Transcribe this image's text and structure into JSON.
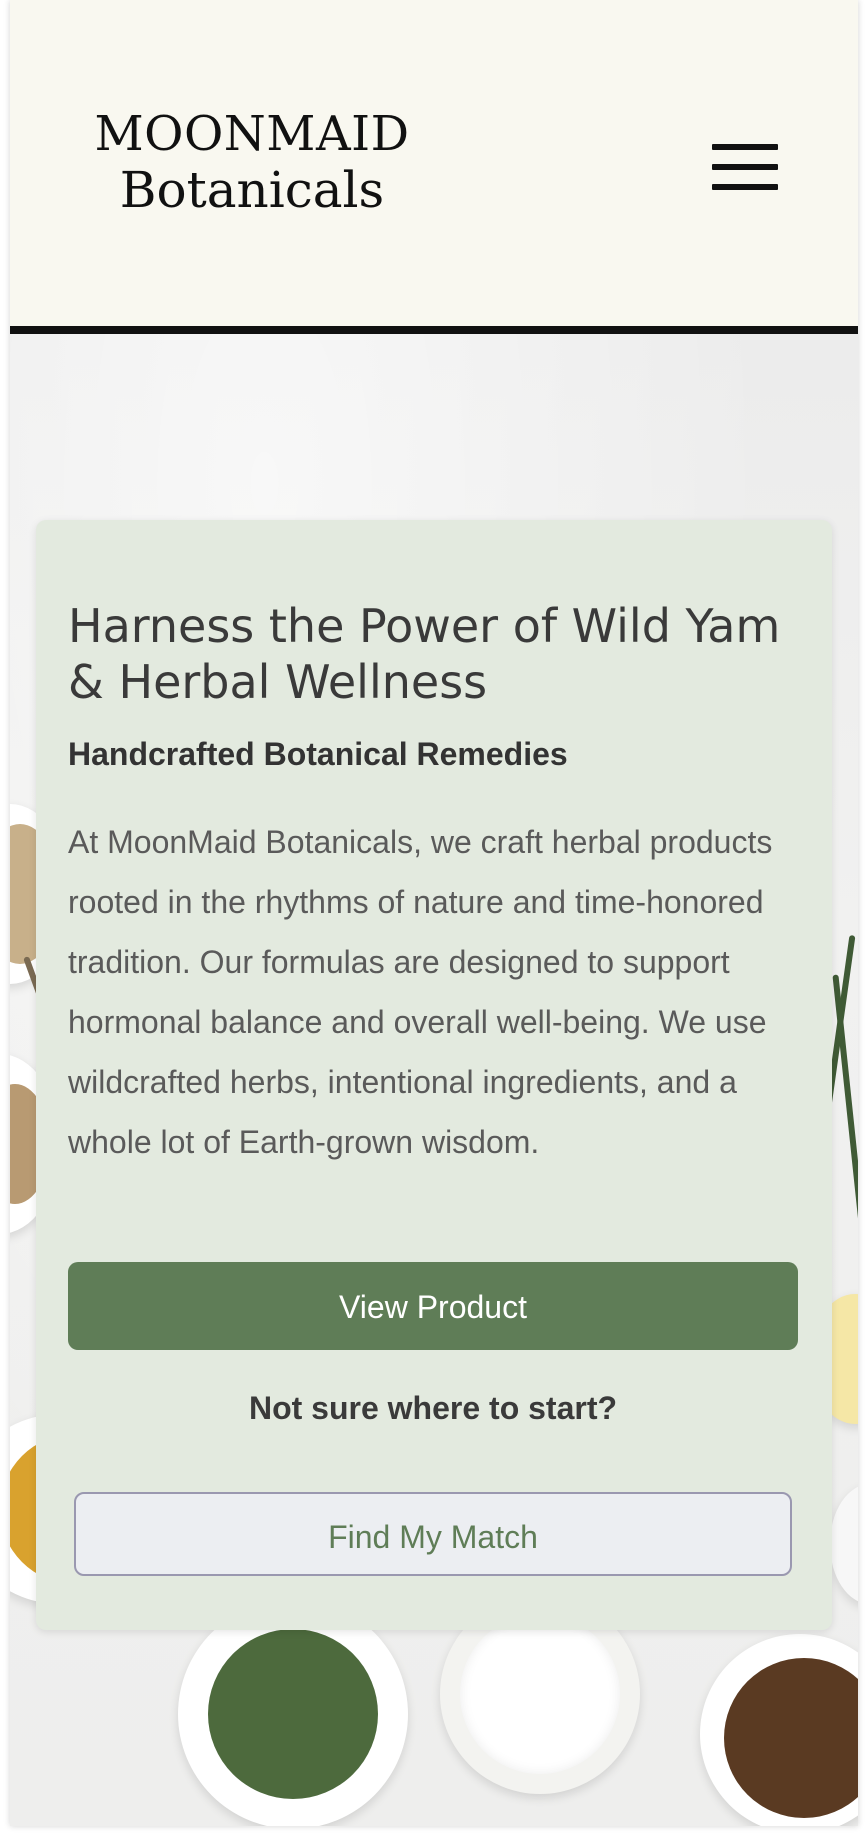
{
  "header": {
    "logo_line1": "MOONMAID",
    "logo_line2": "Botanicals",
    "menu_icon": "hamburger-menu-icon"
  },
  "hero": {
    "title": "Harness the Power of Wild Yam & Herbal Wellness",
    "subtitle": "Handcrafted Botanical Remedies",
    "body": "At MoonMaid Botanicals, we craft herbal products rooted in the rhythms of nature and time-honored tradition. Our formulas are designed to support hormonal balance and overall well-being. We use wildcrafted herbs, intentional ingredients, and a whole lot of Earth-grown wisdom.",
    "primary_button": "View Product",
    "prompt": "Not sure where to start?",
    "secondary_button": "Find My Match"
  },
  "colors": {
    "header_bg": "#f9f8f0",
    "card_bg": "#e3eadf",
    "accent_green": "#5f7d57",
    "secondary_button_bg": "#eceef2"
  }
}
